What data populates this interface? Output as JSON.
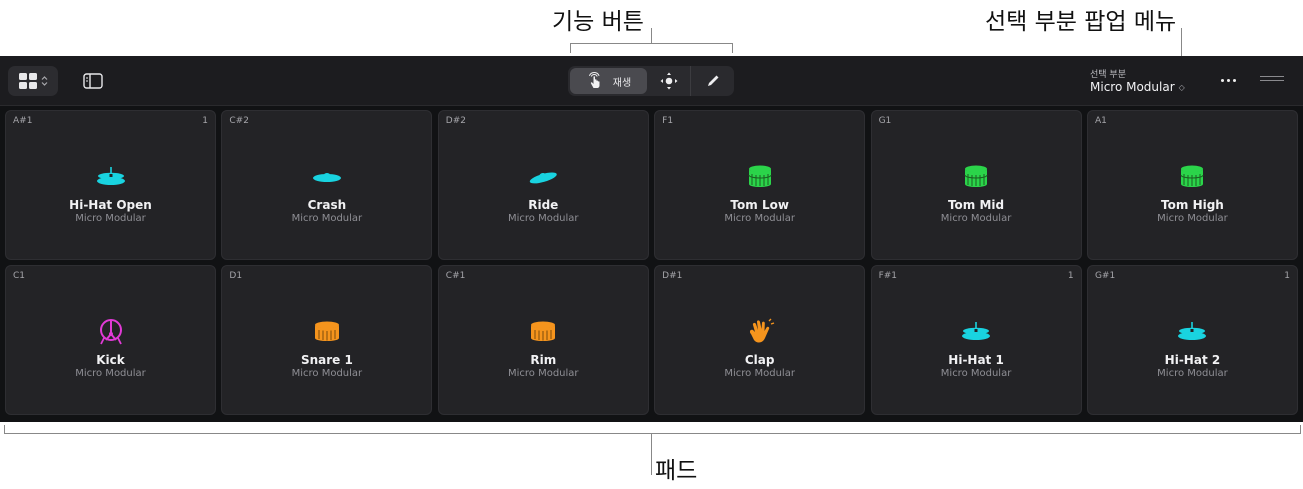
{
  "annotations": {
    "function_buttons": "기능 버튼",
    "selection_popup": "선택 부분 팝업 메뉴",
    "pads": "패드"
  },
  "toolbar": {
    "play_label": "재생",
    "selection_label": "선택 부분",
    "selection_value": "Micro Modular",
    "selection_chevron": "◇"
  },
  "colors": {
    "cyan": "#19d3e0",
    "green": "#2bd44a",
    "magenta": "#e13ad6",
    "orange": "#f5941d"
  },
  "pads": [
    {
      "note": "A#1",
      "count": "1",
      "name": "Hi-Hat Open",
      "kit": "Micro Modular",
      "icon": "hihat-icon"
    },
    {
      "note": "C#2",
      "count": "",
      "name": "Crash",
      "kit": "Micro Modular",
      "icon": "crash-cymbal-icon"
    },
    {
      "note": "D#2",
      "count": "",
      "name": "Ride",
      "kit": "Micro Modular",
      "icon": "ride-cymbal-icon"
    },
    {
      "note": "F1",
      "count": "",
      "name": "Tom Low",
      "kit": "Micro Modular",
      "icon": "tom-drum-icon"
    },
    {
      "note": "G1",
      "count": "",
      "name": "Tom Mid",
      "kit": "Micro Modular",
      "icon": "tom-drum-icon"
    },
    {
      "note": "A1",
      "count": "",
      "name": "Tom High",
      "kit": "Micro Modular",
      "icon": "tom-drum-icon"
    },
    {
      "note": "C1",
      "count": "",
      "name": "Kick",
      "kit": "Micro Modular",
      "icon": "kick-drum-icon"
    },
    {
      "note": "D1",
      "count": "",
      "name": "Snare 1",
      "kit": "Micro Modular",
      "icon": "snare-drum-icon"
    },
    {
      "note": "C#1",
      "count": "",
      "name": "Rim",
      "kit": "Micro Modular",
      "icon": "snare-drum-icon"
    },
    {
      "note": "D#1",
      "count": "",
      "name": "Clap",
      "kit": "Micro Modular",
      "icon": "clap-hand-icon"
    },
    {
      "note": "F#1",
      "count": "1",
      "name": "Hi-Hat 1",
      "kit": "Micro Modular",
      "icon": "hihat-icon"
    },
    {
      "note": "G#1",
      "count": "1",
      "name": "Hi-Hat 2",
      "kit": "Micro Modular",
      "icon": "hihat-icon"
    }
  ]
}
